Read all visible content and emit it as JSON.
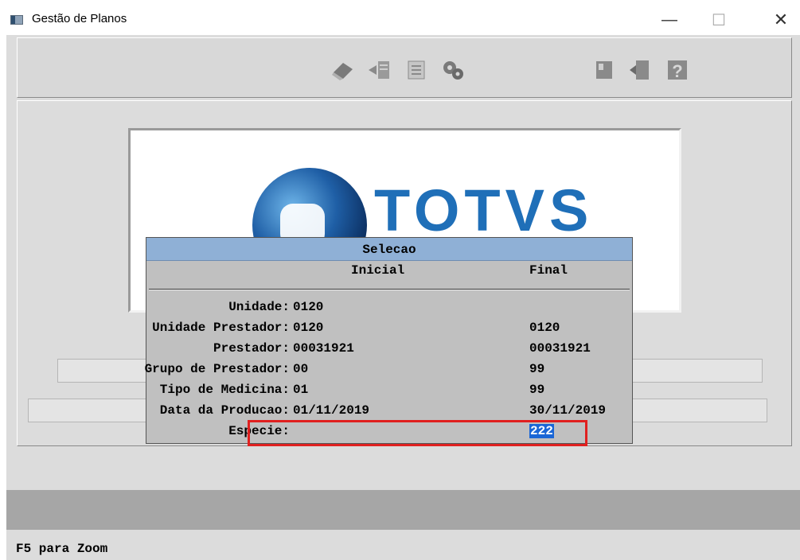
{
  "window": {
    "title": "Gestão de Planos",
    "minimize_glyph": "—",
    "maximize_glyph": "☐",
    "close_glyph": "✕"
  },
  "toolbar": {
    "icons": [
      "eraser-icon",
      "import-icon",
      "checklist-icon",
      "gears-icon",
      "stamp-icon",
      "exit-door-icon",
      "help-question-icon"
    ]
  },
  "logo": {
    "wordmark": "TOTVS",
    "brand_color": "#1f6fb8"
  },
  "dialog": {
    "title": "Selecao",
    "header_initial": "Inicial",
    "header_final": "Final",
    "title_bar_color": "#8fb0d6",
    "rows": [
      {
        "label": "Unidade:",
        "initial": "0120",
        "final": ""
      },
      {
        "label": "Unidade Prestador:",
        "initial": "0120",
        "final": "0120"
      },
      {
        "label": "Prestador:",
        "initial": "00031921",
        "final": "00031921"
      },
      {
        "label": "Grupo de Prestador:",
        "initial": "00",
        "final": "99"
      },
      {
        "label": "Tipo de Medicina:",
        "initial": "01",
        "final": "99"
      },
      {
        "label": "Data da Producao:",
        "initial": "01/11/2019",
        "final": "30/11/2019"
      },
      {
        "label": "Especie:",
        "initial": "",
        "final": "222"
      }
    ],
    "selected_field_color": "#1a66d6",
    "highlight_color": "#e0201f"
  },
  "status": {
    "text": "F5 para Zoom"
  }
}
